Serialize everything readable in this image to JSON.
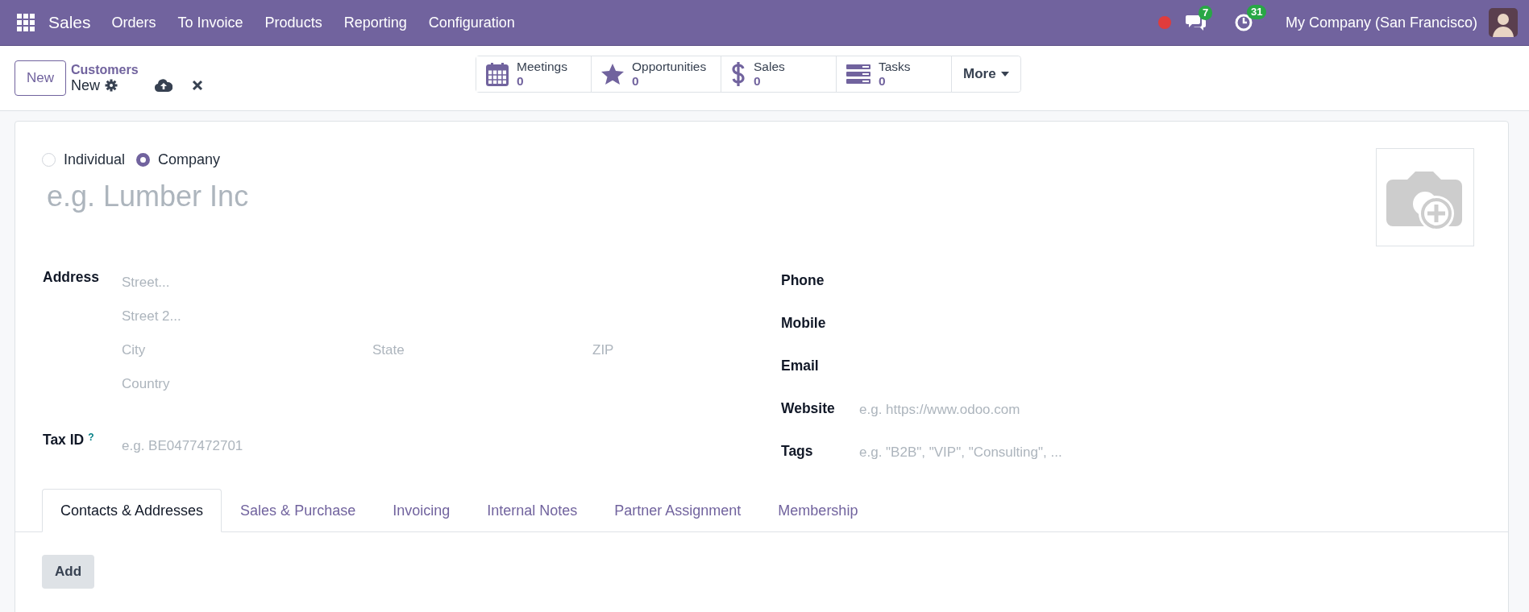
{
  "navbar": {
    "app": "Sales",
    "menu": [
      "Orders",
      "To Invoice",
      "Products",
      "Reporting",
      "Configuration"
    ],
    "messages_count": "7",
    "activities_count": "31",
    "company": "My Company (San Francisco)"
  },
  "control_panel": {
    "new_button": "New",
    "breadcrumb": "Customers",
    "record": "New",
    "stat_buttons": [
      {
        "kind": "calendar",
        "label": "Meetings",
        "value": "0"
      },
      {
        "kind": "star",
        "label": "Opportunities",
        "value": "0"
      },
      {
        "kind": "dollar",
        "label": "Sales",
        "value": "0"
      },
      {
        "kind": "tasks",
        "label": "Tasks",
        "value": "0"
      }
    ],
    "more_button": "More"
  },
  "form": {
    "company_type": [
      {
        "label": "Individual",
        "selected": false
      },
      {
        "label": "Company",
        "selected": true
      }
    ],
    "name": {
      "placeholder": "e.g. Lumber Inc"
    },
    "address_label": "Address",
    "street": {
      "placeholder": "Street..."
    },
    "street2": {
      "placeholder": "Street 2..."
    },
    "city": {
      "placeholder": "City"
    },
    "state": {
      "placeholder": "State"
    },
    "zip": {
      "placeholder": "ZIP"
    },
    "country": {
      "placeholder": "Country"
    },
    "tax_id": {
      "label": "Tax ID",
      "help": "?",
      "placeholder": "e.g. BE0477472701"
    },
    "right_fields": [
      {
        "label": "Phone"
      },
      {
        "label": "Mobile"
      },
      {
        "label": "Email"
      },
      {
        "label": "Website",
        "placeholder": "e.g. https://www.odoo.com"
      },
      {
        "label": "Tags",
        "placeholder": "e.g. \"B2B\", \"VIP\", \"Consulting\", ..."
      }
    ],
    "tabs": [
      {
        "label": "Contacts & Addresses",
        "selected": true
      },
      {
        "label": "Sales & Purchase",
        "selected": false
      },
      {
        "label": "Invoicing",
        "selected": false
      },
      {
        "label": "Internal Notes",
        "selected": false
      },
      {
        "label": "Partner Assignment",
        "selected": false
      },
      {
        "label": "Membership",
        "selected": false
      }
    ],
    "add_button": "Add"
  }
}
